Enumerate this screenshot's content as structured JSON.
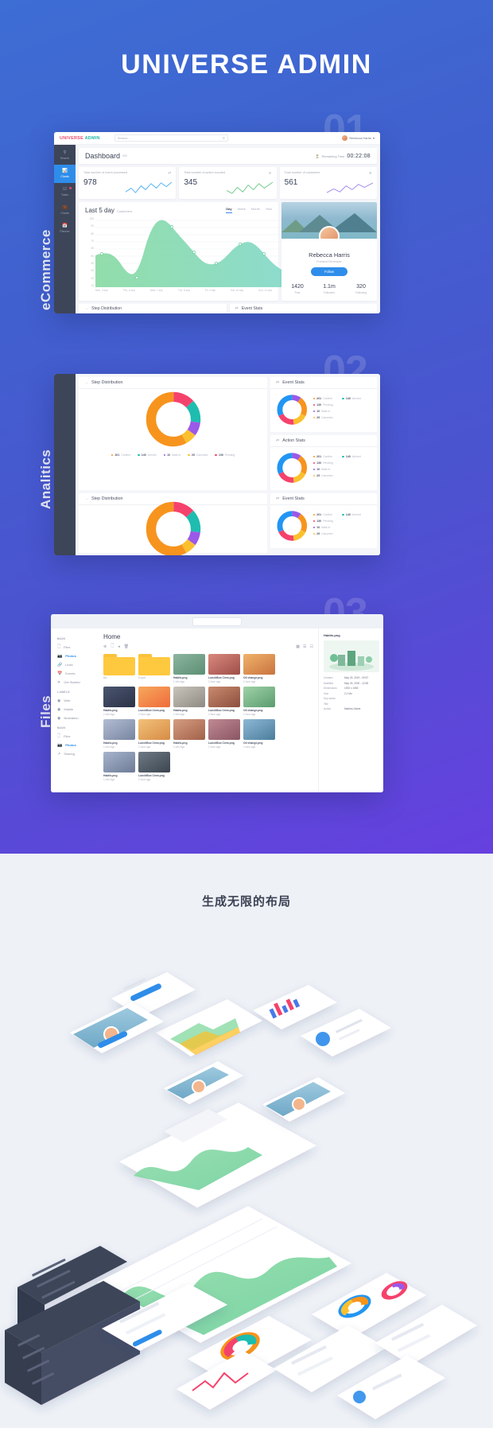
{
  "hero": {
    "title": "UNIVERSE ADMIN"
  },
  "sections": [
    {
      "number": "01",
      "label": "eCommerce"
    },
    {
      "number": "02",
      "label": "Analitics"
    },
    {
      "number": "03",
      "label": "Files"
    }
  ],
  "shot1": {
    "brand_first": "UNIVERSE",
    "brand_second": "ADMIN",
    "search_placeholder": "Search...",
    "search_icon": "search-icon",
    "user_name": "Rebecca Harris",
    "sidebar": [
      {
        "icon": "search-icon",
        "label": "Search",
        "active": false,
        "badge": false
      },
      {
        "icon": "chart-bar-icon",
        "label": "Charts",
        "active": true,
        "badge": false
      },
      {
        "icon": "tasks-icon",
        "label": "Tasks",
        "active": false,
        "badge": true
      },
      {
        "icon": "briefcase-icon",
        "label": "Charts",
        "active": false,
        "badge": false
      },
      {
        "icon": "calendar-icon",
        "label": "Planner",
        "active": false,
        "badge": false
      }
    ],
    "page_title": "Dashboard",
    "page_title_sub": "052",
    "timer_label": "Remaining Time",
    "timer_value": "00:22:08",
    "stats": [
      {
        "label": "Total number\nof event processed",
        "value": "978",
        "icon": "shuffle-icon",
        "color": "#3fa9f5"
      },
      {
        "label": "Total number\nof action excuted",
        "value": "345",
        "icon": "send-icon",
        "color": "#5ec47e"
      },
      {
        "label": "Total number\nof customers",
        "value": "561",
        "icon": "cart-icon",
        "color": "#9a7ee8"
      }
    ],
    "chart_title": "Last 5 day",
    "chart_subtitle": "Customers",
    "chart_tabs": [
      "Day",
      "Week",
      "Month",
      "Year"
    ],
    "chart_tab_active": "Day",
    "profile": {
      "name": "Rebecca Harris",
      "role": "Frontend Developer",
      "follow_label": "Follow",
      "stats": [
        {
          "value": "1420",
          "label": "Post"
        },
        {
          "value": "1.1m",
          "label": "Followers"
        },
        {
          "value": "320",
          "label": "Following"
        }
      ]
    },
    "bottom_cards": [
      {
        "icon": "arrow-right-icon",
        "label": "Step Distribution"
      },
      {
        "icon": "shuffle-icon",
        "label": "Event Stats"
      }
    ]
  },
  "shot2": {
    "panels": [
      {
        "icon": "arrow-right-icon",
        "title": "Step Distribution"
      },
      {
        "icon": "shuffle-icon",
        "title": "Event Stats"
      },
      {
        "icon": "shuffle-icon",
        "title": "Action Stats"
      }
    ],
    "legend": [
      {
        "value": "201",
        "label": "Confirm",
        "color": "#f7941e"
      },
      {
        "value": "140",
        "label": "Arrived",
        "color": "#1fbcb0"
      },
      {
        "value": "130",
        "label": "Pending",
        "color": "#f5426c"
      },
      {
        "value": "10",
        "label": "Walk In",
        "color": "#9b59e8"
      },
      {
        "value": "25",
        "label": "Canceled",
        "color": "#fbc02d"
      }
    ],
    "event_legend": [
      {
        "value": "201",
        "label": "Confirm",
        "color": "#f7941e"
      },
      {
        "value": "140",
        "label": "Arrived",
        "color": "#1fbcb0"
      },
      {
        "value": "130",
        "label": "Pending",
        "color": "#f5426c"
      },
      {
        "value": "10",
        "label": "Walk In",
        "color": "#9b59e8"
      },
      {
        "value": "25",
        "label": "Canceled",
        "color": "#fbc02d"
      }
    ]
  },
  "shot3": {
    "page_title": "Home",
    "toolbar_icons": [
      "add-circle-icon",
      "copy-icon",
      "share-icon",
      "trash-icon"
    ],
    "view_icons": [
      "grid-view-icon",
      "list-view-icon",
      "detail-view-icon"
    ],
    "sidebar_groups": [
      {
        "title": "MAIN",
        "items": [
          {
            "icon": "files-icon",
            "label": "Files",
            "active": false
          },
          {
            "icon": "photos-icon",
            "label": "Photos",
            "active": true
          },
          {
            "icon": "links-icon",
            "label": "Links",
            "active": false
          },
          {
            "icon": "events-icon",
            "label": "Events",
            "active": false
          },
          {
            "icon": "rocket-icon",
            "label": "Get Started",
            "active": false
          }
        ]
      },
      {
        "title": "LABELS",
        "items": [
          {
            "icon": "tag-icon",
            "label": "Web",
            "active": false
          },
          {
            "icon": "tag-icon",
            "label": "Mobile",
            "active": false
          },
          {
            "icon": "tag-icon",
            "label": "Illustration",
            "active": false
          }
        ]
      },
      {
        "title": "MAIN",
        "items": [
          {
            "icon": "files-icon",
            "label": "Files",
            "active": false
          },
          {
            "icon": "photos-icon",
            "label": "Photos",
            "active": true
          },
          {
            "icon": "share-icon",
            "label": "Sharing",
            "active": false
          }
        ]
      }
    ],
    "folders": [
      {
        "name": "Bio"
      },
      {
        "name": "Export"
      }
    ],
    "files": [
      {
        "name": "Habits.png",
        "time": "1 min Ago",
        "thumb": "#8db5a0"
      },
      {
        "name": "LunchBox Crew.png",
        "time": "1 hour ago",
        "thumb": "#c9756a"
      },
      {
        "name": "Oil change.png",
        "time": "1 hour ago",
        "thumb": "#e8a35c"
      },
      {
        "name": "Habits.png",
        "time": "1 min Ago",
        "thumb": "#6d7fa8"
      },
      {
        "name": "LunchBox Crew.png",
        "time": "1 hour ago",
        "thumb": "#b59ed8"
      },
      {
        "name": "Habits.png",
        "time": "1 min Ago",
        "thumb": "#5a7a6d"
      },
      {
        "name": "LunchBox Crew.png",
        "time": "1 hour ago",
        "thumb": "#b96a5e"
      },
      {
        "name": "Oil change.png",
        "time": "1 hour ago",
        "thumb": "#7fae8c"
      },
      {
        "name": "Habits.png",
        "time": "1 min Ago",
        "thumb": "#9aa8c4"
      },
      {
        "name": "LunchBox Crew.png",
        "time": "1 hour ago",
        "thumb": "#d9a25f"
      },
      {
        "name": "Habits.png",
        "time": "1 min Ago",
        "thumb": "#c98a6e"
      },
      {
        "name": "LunchBox Crew.png",
        "time": "1 hour ago",
        "thumb": "#a6757f"
      },
      {
        "name": "Oil change.png",
        "time": "1 hour ago",
        "thumb": "#6f9ab5"
      },
      {
        "name": "Habits.png",
        "time": "1 min Ago",
        "thumb": "#8a9ab8"
      },
      {
        "name": "LunchBox Crew.png",
        "time": "1 hour ago",
        "thumb": "#55626f"
      }
    ],
    "detail": {
      "filename": "Habits.png",
      "meta": [
        {
          "key": "Created",
          "value": "May 25, 2019 - 09:57"
        },
        {
          "key": "Modified",
          "value": "May 25, 2000 - 12:55"
        },
        {
          "key": "Dimensions",
          "value": "1920 x 1080"
        },
        {
          "key": "Size",
          "value": "2.2 Mo"
        },
        {
          "key": "Key words",
          "value": ""
        },
        {
          "key": "Title",
          "value": ""
        },
        {
          "key": "Author",
          "value": "Mathieu Maret"
        }
      ]
    }
  },
  "bottom": {
    "title": "生成无限的布局"
  },
  "chart_data": [
    {
      "type": "area",
      "title": "Last 5 day",
      "subtitle": "Customers",
      "xlabel": "",
      "ylabel": "",
      "ylim": [
        0,
        100
      ],
      "grid": true,
      "legend": "none",
      "categories": [
        "Mon, 3 sep",
        "Thu, 6 sep",
        "Wed, 7 sep",
        "Thu, 8 sep",
        "Fri, 9 sep",
        "Sat, 10 sep",
        "Sun, 11 sep"
      ],
      "values": [
        45,
        30,
        90,
        67,
        33,
        55,
        50,
        28
      ],
      "yticks": [
        100,
        90,
        80,
        70,
        60,
        50,
        40,
        30,
        20,
        10
      ]
    },
    {
      "type": "line",
      "title": "Total number of event processed",
      "values": [
        14,
        22,
        10,
        26,
        18,
        33,
        24,
        40,
        31,
        46
      ],
      "color": "#3fa9f5"
    },
    {
      "type": "line",
      "title": "Total number of action excuted",
      "values": [
        16,
        10,
        24,
        14,
        30,
        20,
        36,
        27,
        44
      ],
      "color": "#5ec47e"
    },
    {
      "type": "line",
      "title": "Total number of customers",
      "values": [
        12,
        20,
        14,
        28,
        22,
        36,
        30,
        42
      ],
      "color": "#9a7ee8"
    },
    {
      "type": "pie",
      "title": "Step Distribution",
      "labels": [
        "Confirm",
        "Arrived",
        "Pending",
        "Walk In",
        "Canceled"
      ],
      "values": [
        201,
        140,
        130,
        10,
        25
      ],
      "colors": [
        "#f7941e",
        "#1fbcb0",
        "#f5426c",
        "#9b59e8",
        "#fbc02d"
      ]
    },
    {
      "type": "pie",
      "title": "Event Stats",
      "labels": [
        "Confirm",
        "Arrived",
        "Pending",
        "Walk In",
        "Canceled"
      ],
      "values": [
        201,
        140,
        130,
        10,
        25
      ],
      "colors": [
        "#f7941e",
        "#1fbcb0",
        "#f5426c",
        "#9b59e8",
        "#fbc02d"
      ]
    },
    {
      "type": "pie",
      "title": "Action Stats",
      "labels": [
        "Confirm",
        "Arrived",
        "Pending",
        "Walk In",
        "Canceled"
      ],
      "values": [
        201,
        140,
        130,
        10,
        25
      ],
      "colors": [
        "#f7941e",
        "#1fbcb0",
        "#f5426c",
        "#9b59e8",
        "#fbc02d"
      ]
    }
  ]
}
